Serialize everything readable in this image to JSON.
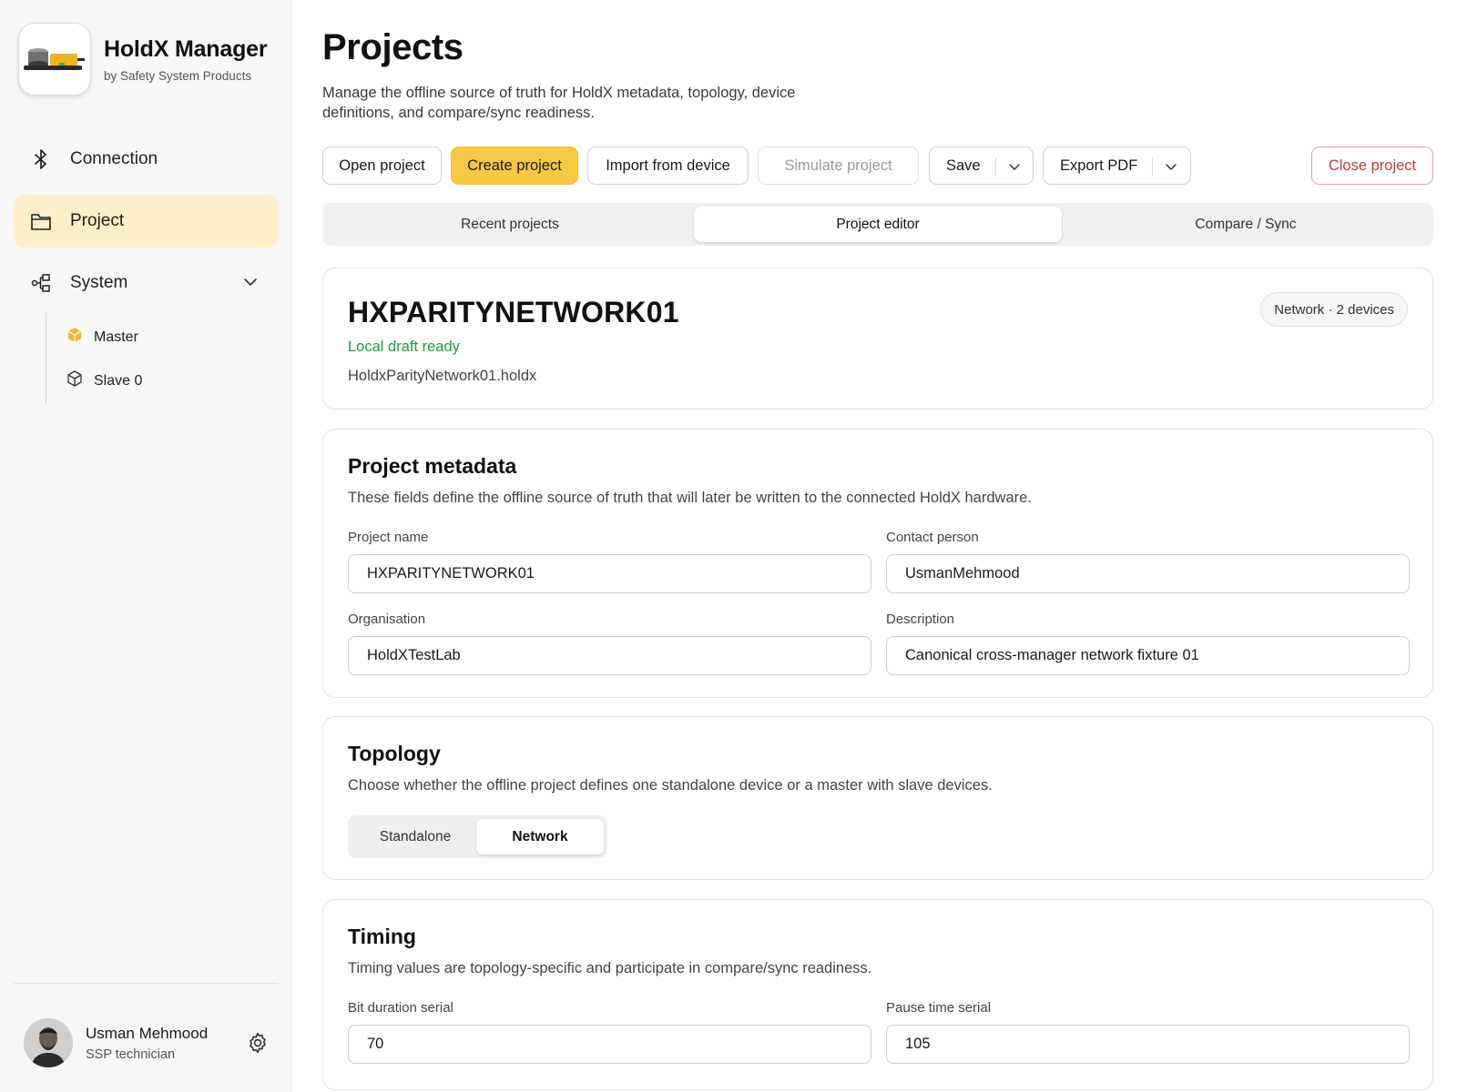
{
  "app": {
    "name": "HoldX Manager",
    "subtitle": "by Safety System Products",
    "logo_icon": "device-logo-icon"
  },
  "sidebar": {
    "nav": [
      {
        "label": "Connection",
        "icon": "bluetooth-icon",
        "active": false
      },
      {
        "label": "Project",
        "icon": "folder-icon",
        "active": true
      },
      {
        "label": "System",
        "icon": "topology-icon",
        "active": false,
        "expanded": true
      }
    ],
    "system_children": [
      {
        "label": "Master",
        "icon": "cube-filled-icon",
        "color": "#f2b632"
      },
      {
        "label": "Slave 0",
        "icon": "cube-outline-icon"
      }
    ],
    "user": {
      "name": "Usman Mehmood",
      "role": "SSP technician",
      "settings_icon": "gear-icon"
    }
  },
  "page": {
    "title": "Projects",
    "description": "Manage the offline source of truth for HoldX metadata, topology, device definitions, and compare/sync readiness."
  },
  "toolbar": {
    "open_label": "Open project",
    "create_label": "Create project",
    "import_label": "Import from device",
    "simulate_label": "Simulate project",
    "save_label": "Save",
    "export_label": "Export PDF",
    "close_label": "Close project"
  },
  "tabs": [
    {
      "label": "Recent projects",
      "active": false
    },
    {
      "label": "Project editor",
      "active": true
    },
    {
      "label": "Compare / Sync",
      "active": false
    }
  ],
  "project": {
    "name": "HXPARITYNETWORK01",
    "status": "Local draft ready",
    "file": "HoldxParityNetwork01.holdx",
    "badge": "Network · 2 devices"
  },
  "metadata": {
    "title": "Project metadata",
    "description": "These fields define the offline source of truth that will later be written to the connected HoldX hardware.",
    "fields": {
      "project_name": {
        "label": "Project name",
        "value": "HXPARITYNETWORK01"
      },
      "contact_person": {
        "label": "Contact person",
        "value": "UsmanMehmood"
      },
      "organisation": {
        "label": "Organisation",
        "value": "HoldXTestLab"
      },
      "description": {
        "label": "Description",
        "value": "Canonical cross-manager network fixture 01"
      }
    }
  },
  "topology": {
    "title": "Topology",
    "description": "Choose whether the offline project defines one standalone device or a master with slave devices.",
    "options": [
      "Standalone",
      "Network"
    ],
    "selected": "Network"
  },
  "timing": {
    "title": "Timing",
    "description": "Timing values are topology-specific and participate in compare/sync readiness.",
    "fields": {
      "bit_duration_serial": {
        "label": "Bit duration serial",
        "value": "70"
      },
      "pause_time_serial": {
        "label": "Pause time serial",
        "value": "105"
      }
    }
  },
  "colors": {
    "accent": "#f7c843",
    "nav_active_bg": "#fdf0c8",
    "status_ok": "#1f9a3e",
    "danger": "#c43b3b"
  }
}
